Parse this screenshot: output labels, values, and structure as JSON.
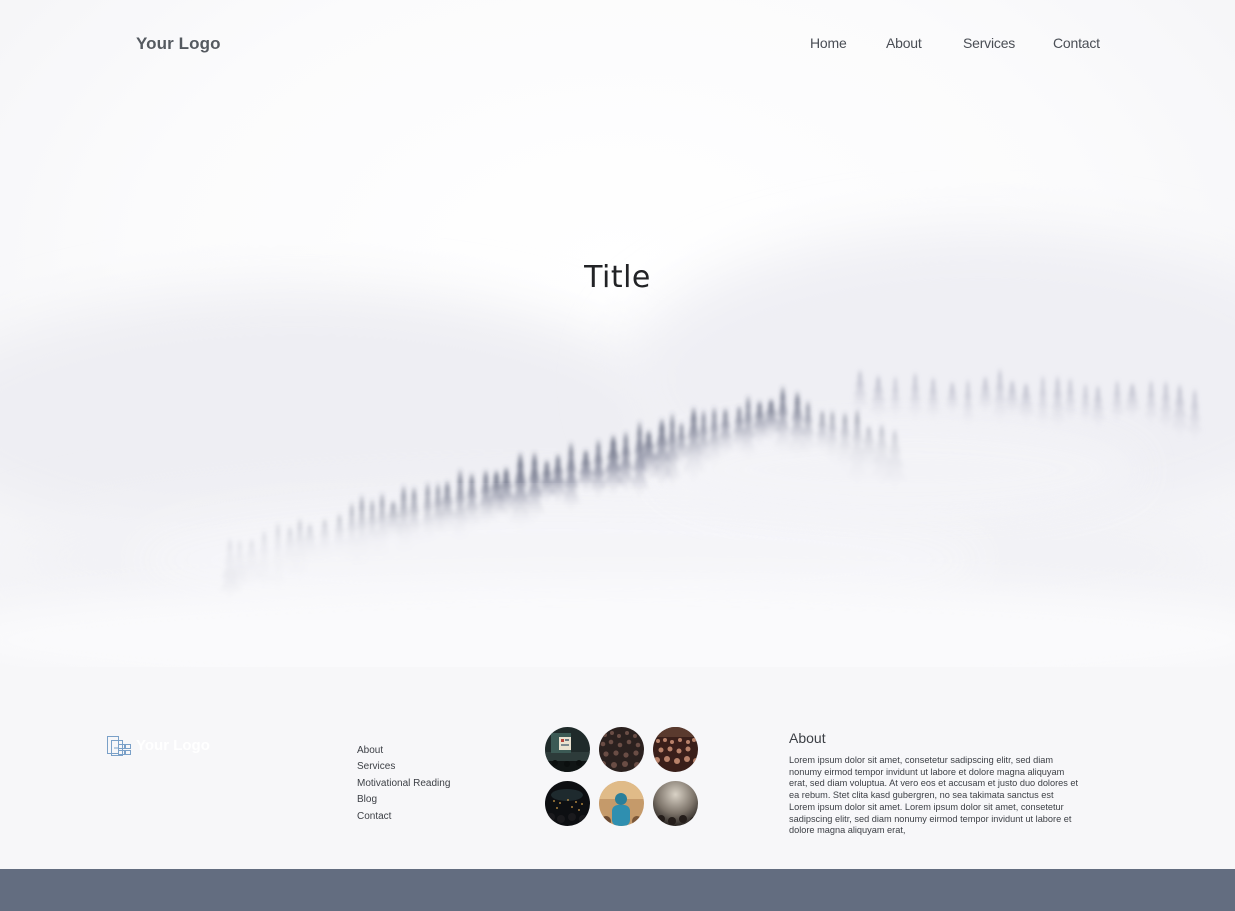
{
  "header": {
    "logo": "Your Logo",
    "nav": [
      {
        "label": "Home"
      },
      {
        "label": "About"
      },
      {
        "label": "Services"
      },
      {
        "label": "Contact"
      }
    ]
  },
  "hero": {
    "title": "Title"
  },
  "footer": {
    "logo_text": "Your Logo",
    "links": [
      {
        "label": "About"
      },
      {
        "label": "Services"
      },
      {
        "label": "Motivational Reading"
      },
      {
        "label": "Blog"
      },
      {
        "label": "Contact"
      }
    ],
    "gallery": [
      {
        "name": "photo-stage-slide"
      },
      {
        "name": "photo-crowd-1"
      },
      {
        "name": "photo-crowd-2"
      },
      {
        "name": "photo-audience-dark"
      },
      {
        "name": "photo-speaker-blue"
      },
      {
        "name": "photo-spotlight"
      }
    ],
    "about": {
      "title": "About",
      "text": "Lorem ipsum dolor sit amet, consetetur sadipscing elitr, sed diam nonumy eirmod tempor invidunt ut labore et dolore magna aliquyam erat, sed diam voluptua. At vero eos et accusam et justo duo dolores et ea rebum. Stet clita kasd gubergren, no sea takimata sanctus est Lorem ipsum dolor sit amet. Lorem ipsum dolor sit amet, consetetur sadipscing elitr, sed diam nonumy eirmod tempor invidunt ut labore et dolore magna aliquyam erat,"
    }
  },
  "colors": {
    "bottom_bar": "#636d80",
    "footer_bg": "#f7f7f9",
    "tree": "#4a5168"
  }
}
